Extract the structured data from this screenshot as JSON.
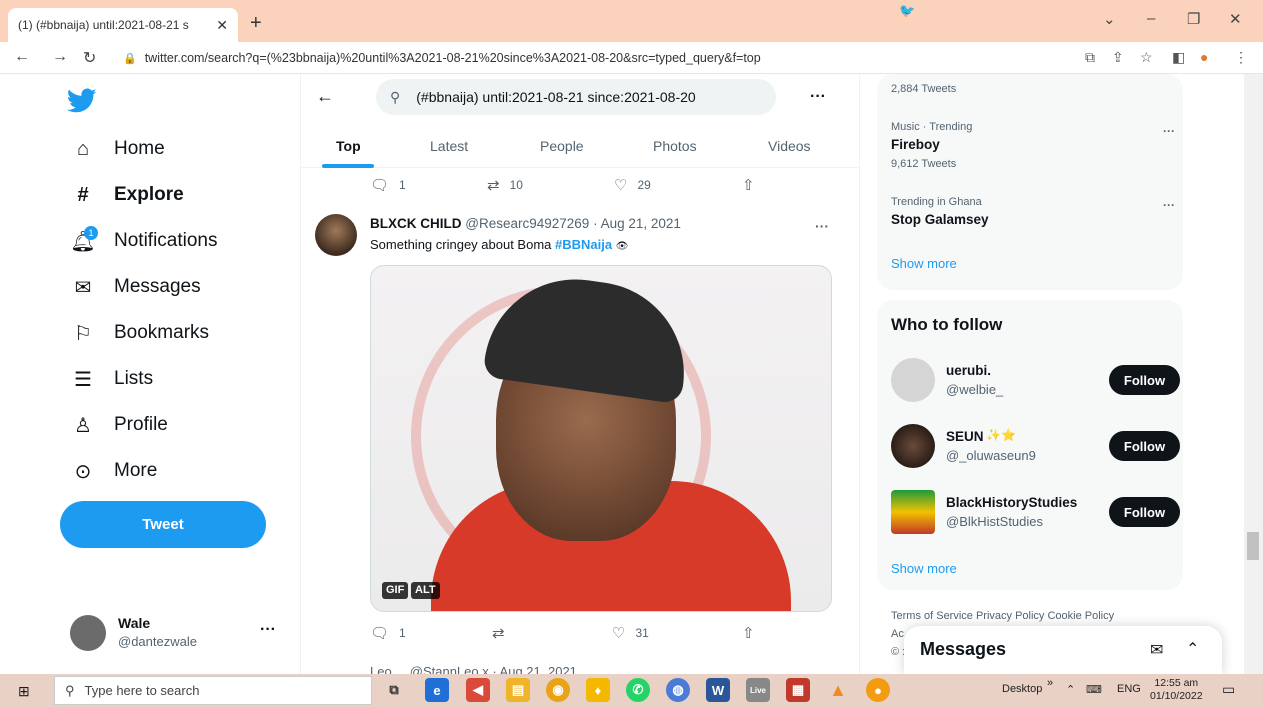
{
  "browser": {
    "tab_title": "(1) (#bbnaija) until:2021-08-21 s",
    "url": "twitter.com/search?q=(%23bbnaija)%20until%3A2021-08-21%20since%3A2021-08-20&src=typed_query&f=top"
  },
  "sidebar": {
    "items": [
      {
        "label": "Home",
        "icon": "home-icon"
      },
      {
        "label": "Explore",
        "icon": "hashtag-icon"
      },
      {
        "label": "Notifications",
        "icon": "bell-icon",
        "badge": "1"
      },
      {
        "label": "Messages",
        "icon": "envelope-icon"
      },
      {
        "label": "Bookmarks",
        "icon": "bookmark-icon"
      },
      {
        "label": "Lists",
        "icon": "list-icon"
      },
      {
        "label": "Profile",
        "icon": "person-icon"
      },
      {
        "label": "More",
        "icon": "more-circle-icon"
      }
    ],
    "tweet_button": "Tweet",
    "account": {
      "name": "Wale",
      "handle": "@dantezwale"
    }
  },
  "search": {
    "query": "(#bbnaija) until:2021-08-21 since:2021-08-20",
    "tabs": [
      "Top",
      "Latest",
      "People",
      "Photos",
      "Videos"
    ]
  },
  "prev_tweet_actions": {
    "replies": "1",
    "retweets": "10",
    "likes": "29"
  },
  "tweet": {
    "author": "BLXCK CHILD",
    "handle": "@Researc94927269",
    "date": "· Aug 21, 2021",
    "text": "Something cringey about Boma",
    "hashtag": "#BBNaija",
    "gif_badge": "GIF",
    "alt_badge": "ALT",
    "replies": "1",
    "likes": "31"
  },
  "next_tweet_peek": "Leo ... @StannLeo x · Aug 21, 2021",
  "trends": [
    {
      "meta": "",
      "name": "",
      "count": "2,884 Tweets"
    },
    {
      "meta": "Music · Trending",
      "name": "Fireboy",
      "count": "9,612 Tweets"
    },
    {
      "meta": "Trending in Ghana",
      "name": "Stop Galamsey",
      "count": ""
    }
  ],
  "show_more": "Show more",
  "who_to_follow": {
    "title": "Who to follow",
    "accounts": [
      {
        "name": "uerubi.",
        "handle": "@welbie_"
      },
      {
        "name": "SEUN",
        "handle": "@_oluwaseun9"
      },
      {
        "name": "BlackHistoryStudies",
        "handle": "@BlkHistStudies"
      }
    ],
    "follow_label": "Follow"
  },
  "footer": "Terms of Service  Privacy Policy  Cookie Policy",
  "footer_line2": "Ac",
  "footer_line3": "© :",
  "messages_dock": "Messages",
  "taskbar": {
    "search_placeholder": "Type here to search",
    "desktop_label": "Desktop",
    "language": "ENG",
    "time": "12:55 am",
    "date": "01/10/2022"
  }
}
